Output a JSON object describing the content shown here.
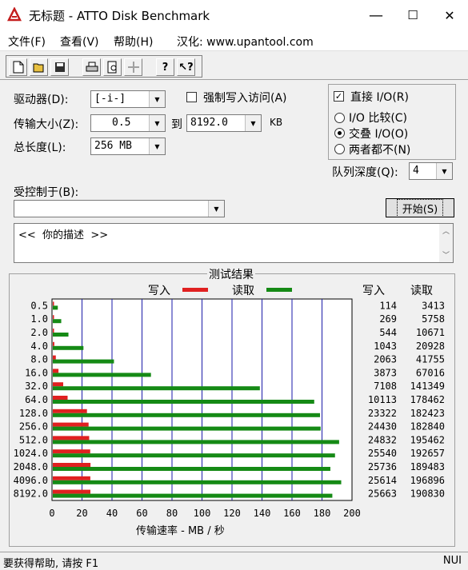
{
  "window": {
    "title": "无标题 - ATTO Disk Benchmark",
    "minimize": "—",
    "maximize": "☐",
    "close": "✕"
  },
  "menu": {
    "file": "文件(F)",
    "view": "查看(V)",
    "help": "帮助(H)",
    "localized": "汉化: www.upantool.com"
  },
  "toolbar": {
    "icons": [
      "new-icon",
      "open-icon",
      "save-icon",
      "print-icon",
      "print-preview-icon",
      "move-icon",
      "help-icon",
      "context-help-icon"
    ]
  },
  "settings": {
    "drive_label": "驱动器(D):",
    "drive_value": "[-i-]",
    "force_write_label": "强制写入访问(A)",
    "force_write_checked": false,
    "transfer_label": "传输大小(Z):",
    "transfer_from": "0.5",
    "to_label": "到",
    "transfer_to": "8192.0",
    "kb_label": "KB",
    "length_label": "总长度(L):",
    "length_value": "256 MB",
    "direct_io_label": "直接 I/O(R)",
    "direct_io_checked": true,
    "io_compare_label": "I/O 比较(C)",
    "overlapped_io_label": "交叠 I/O(O)",
    "neither_label": "两者都不(N)",
    "queue_depth_label": "队列深度(Q):",
    "queue_depth_value": "4",
    "controlled_by_label": "受控制于(B):",
    "controlled_by_value": "",
    "start_button": "开始(S)",
    "description": "<<  你的描述  >>"
  },
  "results": {
    "title": "测试结果",
    "write_legend": "写入",
    "read_legend": "读取",
    "write_col": "写入",
    "read_col": "读取",
    "xlabel": "传输速率 - MB / 秒"
  },
  "chart_data": {
    "type": "bar",
    "orientation": "horizontal",
    "title": "测试结果",
    "xlabel": "传输速率 - MB / 秒",
    "xlim": [
      0,
      200
    ],
    "xticks": [
      0,
      20,
      40,
      60,
      80,
      100,
      120,
      140,
      160,
      180,
      200
    ],
    "categories": [
      "0.5",
      "1.0",
      "2.0",
      "4.0",
      "8.0",
      "16.0",
      "32.0",
      "64.0",
      "128.0",
      "256.0",
      "512.0",
      "1024.0",
      "2048.0",
      "4096.0",
      "8192.0"
    ],
    "series": [
      {
        "name": "写入",
        "color": "#e02020",
        "values": [
          114,
          269,
          544,
          1043,
          2063,
          3873,
          7108,
          10113,
          23322,
          24430,
          24832,
          25540,
          25736,
          25614,
          25663
        ]
      },
      {
        "name": "读取",
        "color": "#158a15",
        "values": [
          3413,
          5758,
          10671,
          20928,
          41755,
          67016,
          141349,
          178462,
          182423,
          182840,
          195462,
          192657,
          189483,
          196896,
          190830
        ]
      }
    ],
    "value_units": "KB/s",
    "grid": true,
    "legend_position": "top"
  },
  "status": {
    "help_text": "要获得帮助, 请按 F1",
    "indicator": "NUI"
  }
}
